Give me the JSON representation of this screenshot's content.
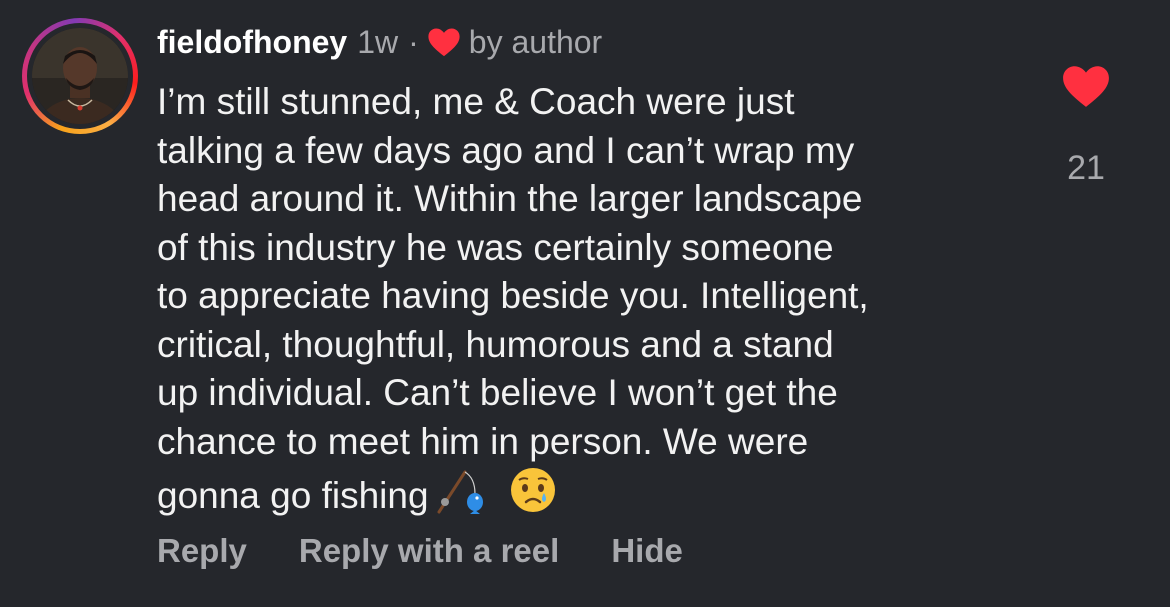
{
  "comment": {
    "username": "fieldofhoney",
    "time_ago": "1w",
    "separator": "·",
    "liked_by_label": "by author",
    "text": "I’m still stunned, me & Coach were just\ntalking a few days ago and I can’t wrap my\nhead around it. Within the larger landscape\nof this industry he was certainly someone\nto appreciate having beside you. Intelligent,\ncritical, thoughtful, humorous and a stand\nup individual. Can’t believe I won’t get the\nchance to meet him in person. We were\ngonna go fishing",
    "emojis": [
      "fishing-pole-emoji",
      "crying-face-emoji"
    ],
    "like_count": "21",
    "liked": true
  },
  "actions": {
    "reply": "Reply",
    "reply_reel": "Reply with a reel",
    "hide": "Hide"
  },
  "colors": {
    "background": "#25272c",
    "heart": "#ff3040",
    "muted": "#a8a9ad"
  }
}
